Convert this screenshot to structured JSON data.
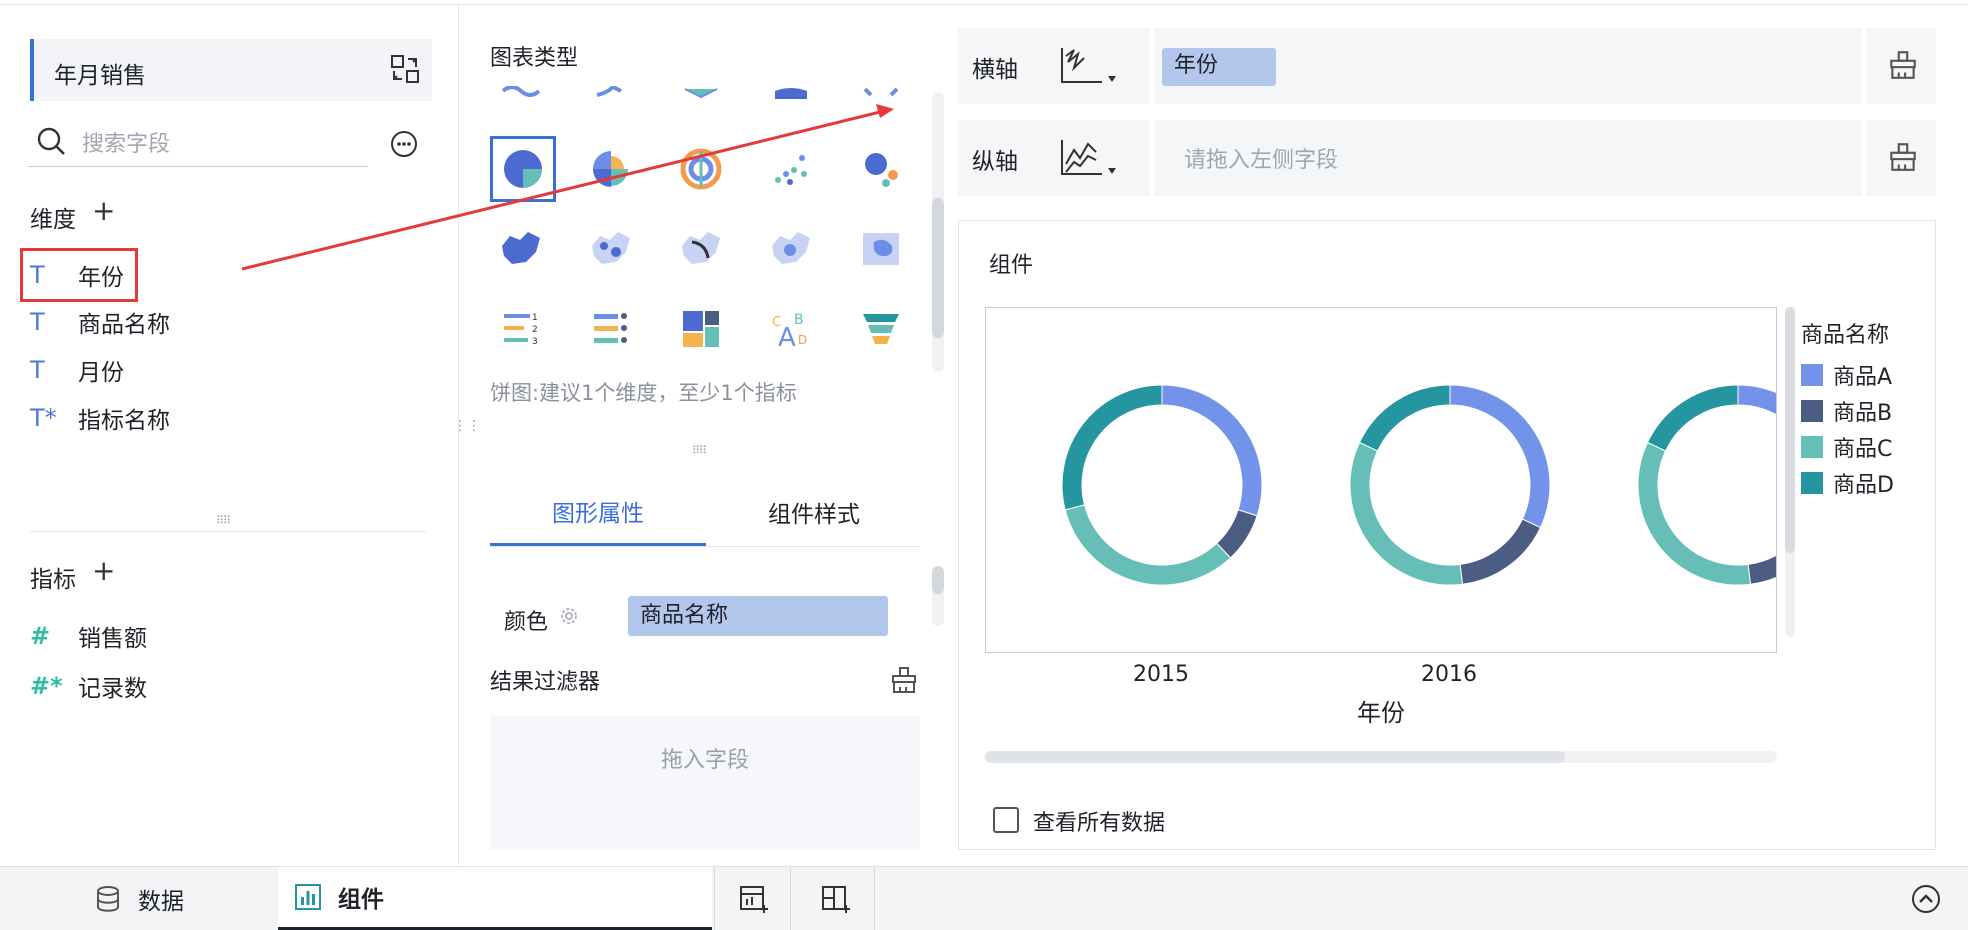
{
  "dataset": {
    "name": "年月销售"
  },
  "search": {
    "placeholder": "搜索字段"
  },
  "dimensions": {
    "title": "维度",
    "add": "+",
    "fields": [
      {
        "icon": "T",
        "label": "年份"
      },
      {
        "icon": "T",
        "label": "商品名称"
      },
      {
        "icon": "T",
        "label": "月份"
      },
      {
        "icon": "T*",
        "label": "指标名称"
      }
    ]
  },
  "measures": {
    "title": "指标",
    "add": "+",
    "fields": [
      {
        "icon": "#",
        "label": "销售额"
      },
      {
        "icon": "#*",
        "label": "记录数"
      }
    ]
  },
  "chart_types": {
    "title": "图表类型",
    "hint": "饼图:建议1个维度，至少1个指标"
  },
  "tabs": {
    "graph_props": "图形属性",
    "component_style": "组件样式"
  },
  "props": {
    "color_label": "颜色",
    "color_field": "商品名称"
  },
  "filter": {
    "title": "结果过滤器",
    "drop_hint": "拖入字段"
  },
  "axes": {
    "x_label": "横轴",
    "x_field": "年份",
    "y_label": "纵轴",
    "y_placeholder": "请拖入左侧字段"
  },
  "component": {
    "title": "组件",
    "view_all": "查看所有数据"
  },
  "bottom": {
    "data_tab": "数据",
    "component_tab": "组件"
  },
  "colors": {
    "A": "#7393ea",
    "B": "#4c5d82",
    "C": "#65bfb7",
    "D": "#2596a0",
    "accent": "#3b6fd8"
  },
  "chart_data": {
    "type": "pie",
    "xlabel": "年份",
    "legend_title": "商品名称",
    "legend_position": "right",
    "categories": [
      "2015",
      "2016"
    ],
    "series": [
      {
        "name": "商品A",
        "values": [
          30,
          32
        ]
      },
      {
        "name": "商品B",
        "values": [
          8,
          16
        ]
      },
      {
        "name": "商品C",
        "values": [
          33,
          34
        ]
      },
      {
        "name": "商品D",
        "values": [
          29,
          18
        ]
      }
    ]
  }
}
